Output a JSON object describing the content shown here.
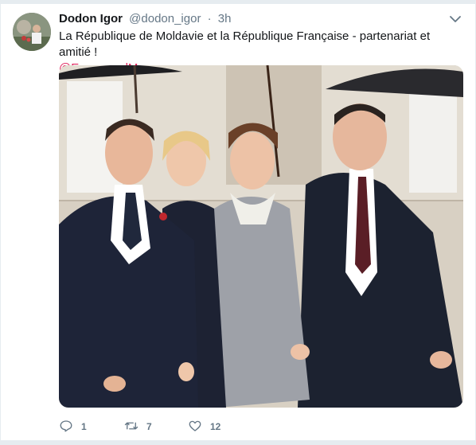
{
  "tweet": {
    "author_name": "Dodon Igor",
    "handle": "@dodon_igor",
    "separator": "·",
    "time": "3h",
    "text": "La République de Moldavie et la République Française - partenariat et amitié !",
    "mention": "@EmmanuelMacron",
    "actions": {
      "reply_count": "1",
      "retweet_count": "7",
      "like_count": "12"
    }
  },
  "colors": {
    "mention": "#e0245e",
    "secondary_text": "#657786",
    "border": "#e6ecf0"
  },
  "icons": [
    "chevron-down-icon",
    "reply-icon",
    "retweet-icon",
    "heart-icon"
  ]
}
